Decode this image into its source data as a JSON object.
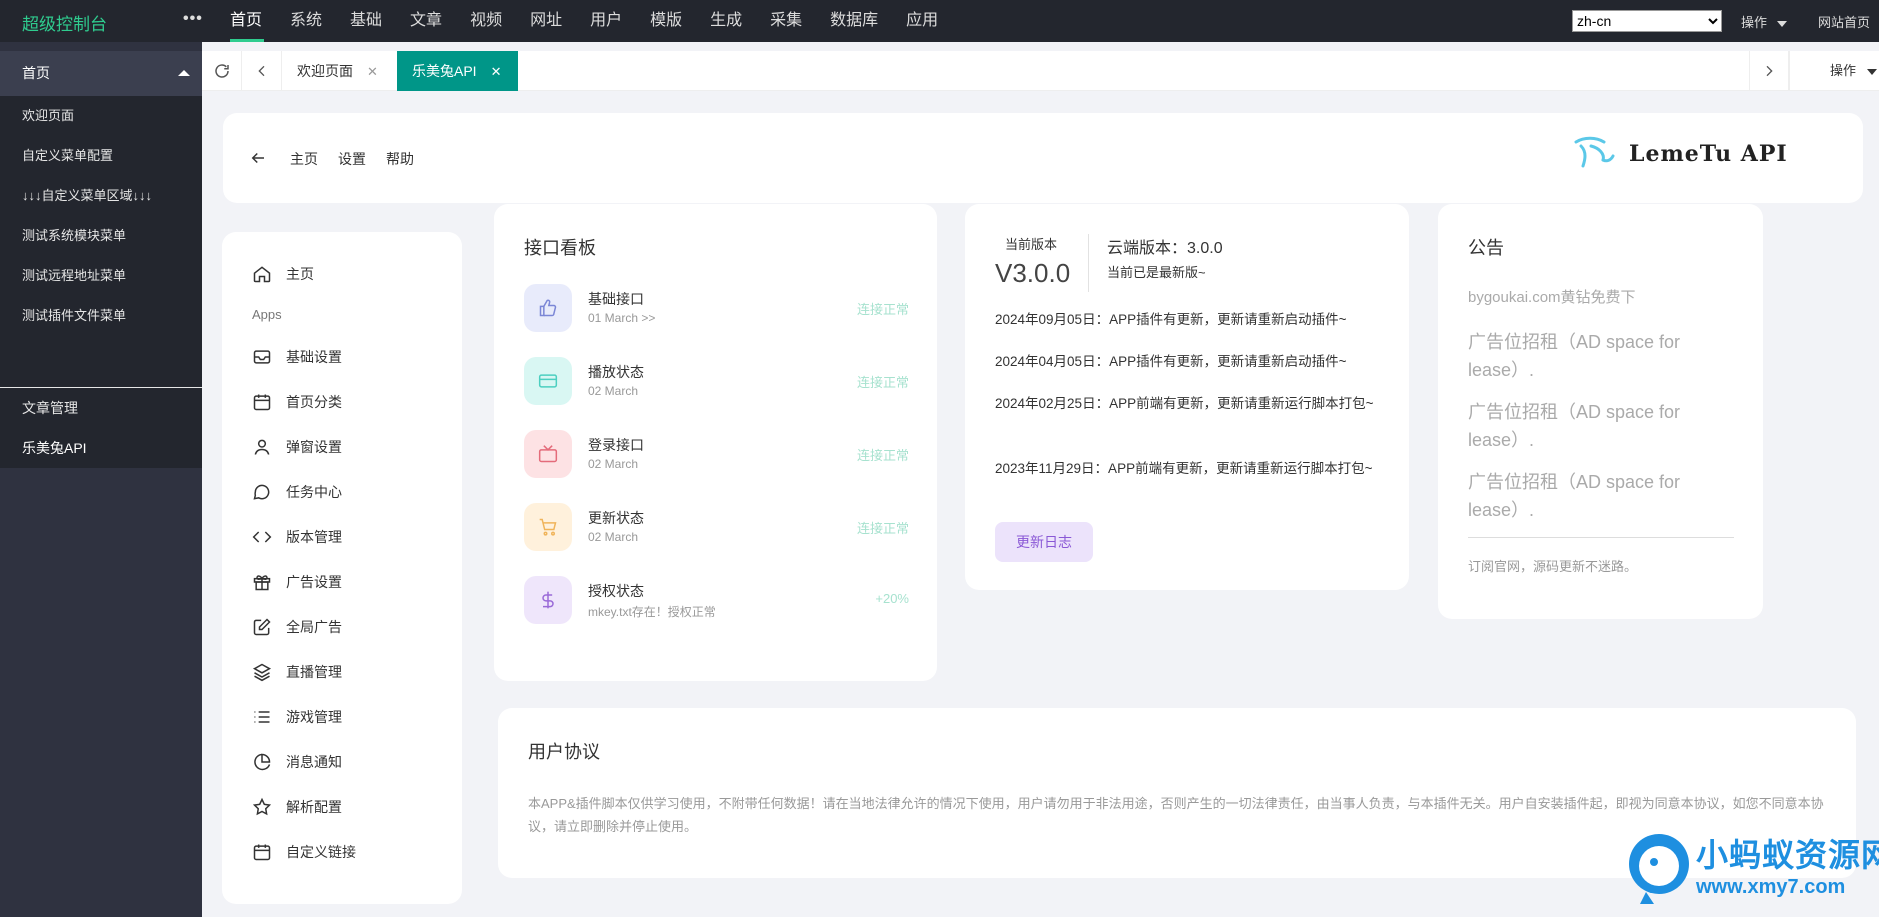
{
  "topbar": {
    "brand": "超级控制台",
    "more": "•••",
    "nav": [
      "首页",
      "系统",
      "基础",
      "文章",
      "视频",
      "网址",
      "用户",
      "模版",
      "生成",
      "采集",
      "数据库",
      "应用"
    ],
    "lang_selected": "zh-cn",
    "operation": "操作",
    "site_home": "网站首页"
  },
  "sidebar": {
    "header": "首页",
    "sub_items": [
      "欢迎页面",
      "自定义菜单配置",
      "↓↓↓自定义菜单区域↓↓↓",
      "测试系统模块菜单",
      "测试远程地址菜单",
      "测试插件文件菜单"
    ],
    "lower_items": [
      "文章管理",
      "乐美兔API"
    ]
  },
  "tabs": {
    "items": [
      "欢迎页面",
      "乐美兔API"
    ],
    "close": "✕",
    "operation": "操作"
  },
  "header": {
    "links": [
      "主页",
      "设置",
      "帮助"
    ],
    "logo_text": "LemeTu API"
  },
  "menu": {
    "home": "主页",
    "section": "Apps",
    "items": [
      "基础设置",
      "首页分类",
      "弹窗设置",
      "任务中心",
      "版本管理",
      "广告设置",
      "全局广告",
      "直播管理",
      "游戏管理",
      "消息通知",
      "解析配置",
      "自定义链接"
    ]
  },
  "api_board": {
    "title": "接口看板",
    "rows": [
      {
        "name": "基础接口",
        "sub": "01 March >>",
        "status": "连接正常",
        "icon": "thumbs-up-icon"
      },
      {
        "name": "播放状态",
        "sub": "02 March",
        "status": "连接正常",
        "icon": "credit-card-icon"
      },
      {
        "name": "登录接口",
        "sub": "02 March",
        "status": "连接正常",
        "icon": "tv-icon"
      },
      {
        "name": "更新状态",
        "sub": "02 March",
        "status": "连接正常",
        "icon": "cart-icon"
      },
      {
        "name": "授权状态",
        "sub": "mkey.txt存在！授权正常",
        "status": "+20%",
        "icon": "dollar-icon"
      }
    ]
  },
  "version": {
    "current_label": "当前版本",
    "current": "V3.0.0",
    "cloud": "云端版本：3.0.0",
    "latest": "当前已是最新版~",
    "logs": [
      "2024年09月05日：APP插件有更新，更新请重新启动插件~",
      "2024年04月05日：APP插件有更新，更新请重新启动插件~",
      "2024年02月25日：APP前端有更新，更新请重新运行脚本打包~",
      "2023年11月29日：APP前端有更新，更新请重新运行脚本打包~"
    ],
    "button": "更新日志"
  },
  "notice": {
    "title": "公告",
    "line1": "bygoukai.com黄钻免费下",
    "ads": [
      "广告位招租（AD space for lease）.",
      "广告位招租（AD space for lease）.",
      "广告位招租（AD space for lease）."
    ],
    "footer": "订阅官网，源码更新不迷路。"
  },
  "agreement": {
    "title": "用户协议",
    "text": "本APP&插件脚本仅供学习使用，不附带任何数据！请在当地法律允许的情况下使用，用户请勿用于非法用途，否则产生的一切法律责任，由当事人负责，与本插件无关。用户自安装插件起，即视为同意本协议，如您不同意本协议，请立即删除并停止使用。"
  },
  "watermark": {
    "line1": "小蚂蚁资源网",
    "line2": "www.xmy7.com"
  },
  "colors": {
    "topbar": "#23262e",
    "brand": "#2fcc8f",
    "tab_active": "#009688",
    "status_ok": "#a7e2cf",
    "update_btn_bg": "#ece3fb",
    "update_btn_text": "#8a58d6",
    "watermark": "#1e8fe0"
  }
}
